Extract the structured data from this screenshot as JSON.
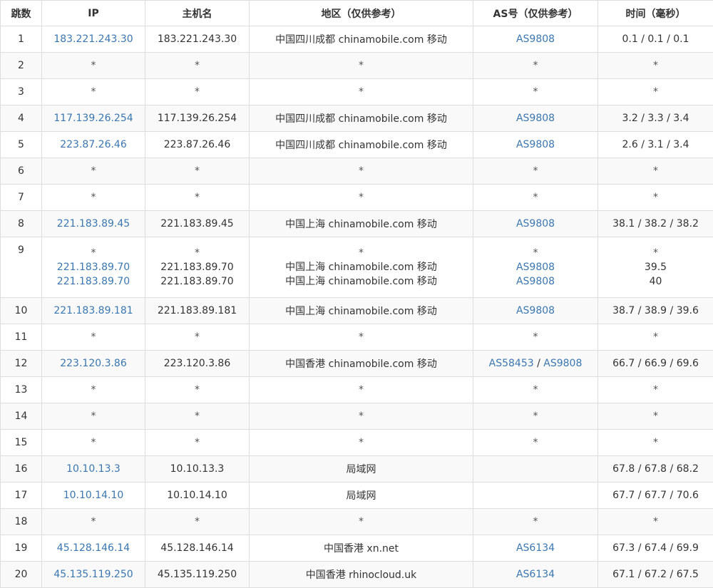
{
  "headers": {
    "hop": "跳数",
    "ip": "IP",
    "host": "主机名",
    "region": "地区（仅供参考）",
    "as": "AS号（仅供参考）",
    "time": "时间（毫秒）"
  },
  "link_color": "#3a77b0",
  "rows": [
    {
      "hop": "1",
      "ip": "183.221.243.30",
      "host": "183.221.243.30",
      "region": "中国四川成都 chinamobile.com 移动",
      "as1": "AS9808",
      "time": "0.1 / 0.1 / 0.1"
    },
    {
      "hop": "2",
      "ip": "*",
      "host": "*",
      "region": "*",
      "as1": "*",
      "time": "*"
    },
    {
      "hop": "3",
      "ip": "*",
      "host": "*",
      "region": "*",
      "as1": "*",
      "time": "*"
    },
    {
      "hop": "4",
      "ip": "117.139.26.254",
      "host": "117.139.26.254",
      "region": "中国四川成都 chinamobile.com 移动",
      "as1": "AS9808",
      "time": "3.2 / 3.3 / 3.4"
    },
    {
      "hop": "5",
      "ip": "223.87.26.46",
      "host": "223.87.26.46",
      "region": "中国四川成都 chinamobile.com 移动",
      "as1": "AS9808",
      "time": "2.6 / 3.1 / 3.4"
    },
    {
      "hop": "6",
      "ip": "*",
      "host": "*",
      "region": "*",
      "as1": "*",
      "time": "*"
    },
    {
      "hop": "7",
      "ip": "*",
      "host": "*",
      "region": "*",
      "as1": "*",
      "time": "*"
    },
    {
      "hop": "8",
      "ip": "221.183.89.45",
      "host": "221.183.89.45",
      "region": "中国上海 chinamobile.com 移动",
      "as1": "AS9808",
      "time": "38.1 / 38.2 / 38.2"
    },
    {
      "hop": "9",
      "lines": [
        {
          "ip": "*",
          "host": "*",
          "region": "*",
          "as1": "*",
          "time": "*"
        },
        {
          "ip": "221.183.89.70",
          "host": "221.183.89.70",
          "region": "中国上海 chinamobile.com 移动",
          "as1": "AS9808",
          "time": "39.5"
        },
        {
          "ip": "221.183.89.70",
          "host": "221.183.89.70",
          "region": "中国上海 chinamobile.com 移动",
          "as1": "AS9808",
          "time": "40"
        }
      ]
    },
    {
      "hop": "10",
      "ip": "221.183.89.181",
      "host": "221.183.89.181",
      "region": "中国上海 chinamobile.com 移动",
      "as1": "AS9808",
      "time": "38.7 / 38.9 / 39.6"
    },
    {
      "hop": "11",
      "ip": "*",
      "host": "*",
      "region": "*",
      "as1": "*",
      "time": "*"
    },
    {
      "hop": "12",
      "ip": "223.120.3.86",
      "host": "223.120.3.86",
      "region": "中国香港 chinamobile.com 移动",
      "as1": "AS58453",
      "as_sep": " / ",
      "as2": "AS9808",
      "time": "66.7 / 66.9 / 69.6"
    },
    {
      "hop": "13",
      "ip": "*",
      "host": "*",
      "region": "*",
      "as1": "*",
      "time": "*"
    },
    {
      "hop": "14",
      "ip": "*",
      "host": "*",
      "region": "*",
      "as1": "*",
      "time": "*"
    },
    {
      "hop": "15",
      "ip": "*",
      "host": "*",
      "region": "*",
      "as1": "*",
      "time": "*"
    },
    {
      "hop": "16",
      "ip": "10.10.13.3",
      "host": "10.10.13.3",
      "region": "局域网",
      "as1": "",
      "time": "67.8 / 67.8 / 68.2"
    },
    {
      "hop": "17",
      "ip": "10.10.14.10",
      "host": "10.10.14.10",
      "region": "局域网",
      "as1": "",
      "time": "67.7 / 67.7 / 70.6"
    },
    {
      "hop": "18",
      "ip": "*",
      "host": "*",
      "region": "*",
      "as1": "*",
      "time": "*"
    },
    {
      "hop": "19",
      "ip": "45.128.146.14",
      "host": "45.128.146.14",
      "region": "中国香港 xn.net",
      "as1": "AS6134",
      "time": "67.3 / 67.4 / 69.9"
    },
    {
      "hop": "20",
      "ip": "45.135.119.250",
      "host": "45.135.119.250",
      "region": "中国香港 rhinocloud.uk",
      "as1": "AS6134",
      "time": "67.1 / 67.2 / 67.5"
    }
  ]
}
